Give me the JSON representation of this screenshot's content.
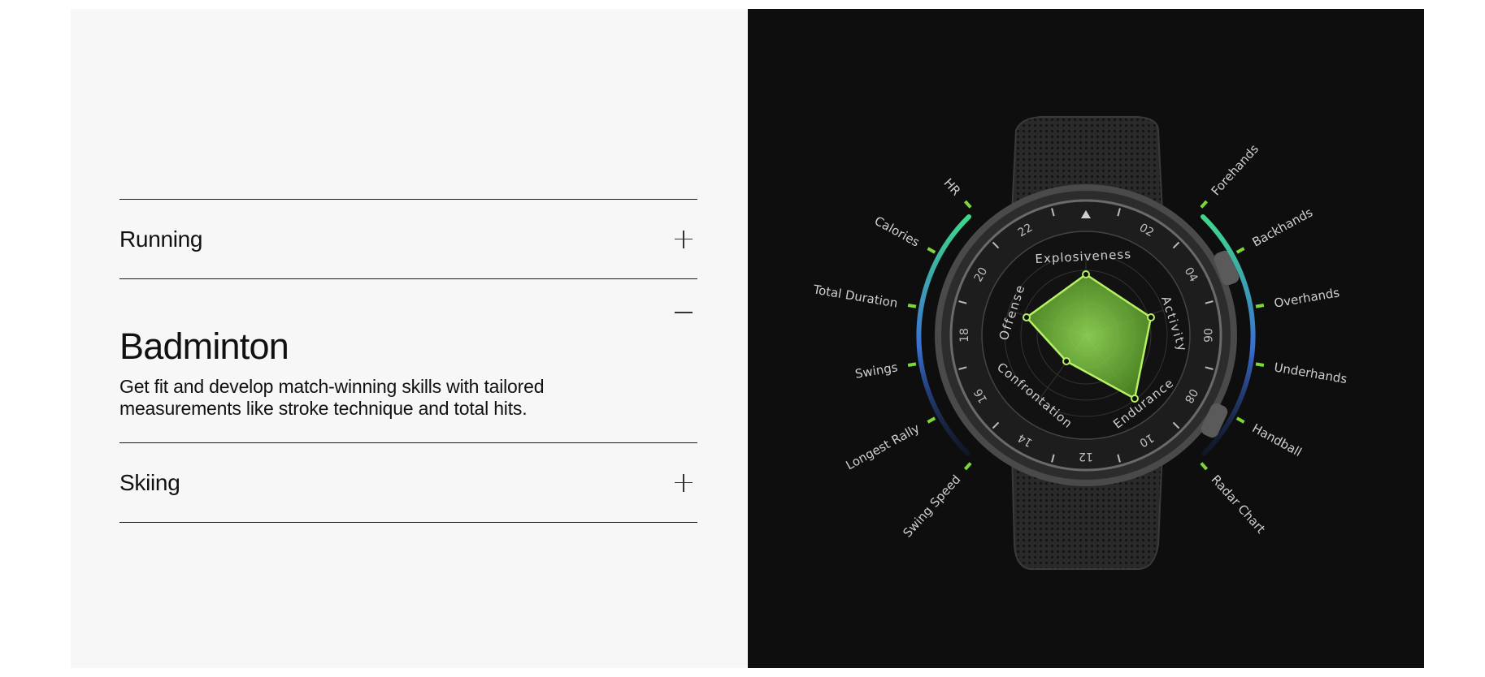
{
  "accordion": {
    "items": [
      {
        "title": "Running",
        "state": "collapsed",
        "icon": "plus-icon"
      },
      {
        "title": "Badminton",
        "state": "expanded",
        "icon": "minus-icon",
        "body_line1": "Get fit and develop match-winning skills with tailored",
        "body_line2": "measurements like stroke technique and total hits."
      },
      {
        "title": "Skiing",
        "state": "collapsed",
        "icon": "plus-icon"
      }
    ]
  },
  "watch": {
    "left_metrics": [
      "HR",
      "Calories",
      "Total Duration",
      "Swings",
      "Longest Rally",
      "Swing Speed"
    ],
    "right_metrics": [
      "Forehands",
      "Backhands",
      "Overhands",
      "Underhands",
      "Handball",
      "Radar Chart"
    ],
    "radar_axes": [
      "Explosiveness",
      "Activity",
      "Endurance",
      "Confrontation",
      "Offense"
    ],
    "bezel_numbers": [
      "02",
      "04",
      "06",
      "08",
      "10",
      "12",
      "14",
      "16",
      "18",
      "20",
      "22"
    ],
    "accent_green": "#7dd63a",
    "gauge_gradient": [
      "#3ed98a",
      "#3a6fd4"
    ]
  }
}
